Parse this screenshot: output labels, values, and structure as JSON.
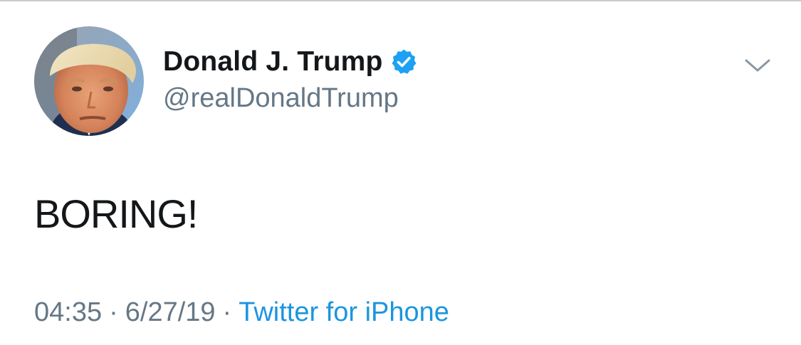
{
  "tweet": {
    "author": {
      "display_name": "Donald J. Trump",
      "handle": "@realDonaldTrump",
      "verified": true,
      "verified_icon": "verified-badge-icon",
      "avatar_icon": "profile-photo"
    },
    "text": "BORING!",
    "meta": {
      "time": "04:35",
      "separator": "·",
      "date": "6/27/19",
      "source": "Twitter for iPhone"
    },
    "menu_icon": "chevron-down-icon"
  },
  "colors": {
    "text_primary": "#14171a",
    "text_secondary": "#657786",
    "link": "#1b95e0",
    "verified_blue": "#1da1f2",
    "divider": "#c8ccd1"
  }
}
